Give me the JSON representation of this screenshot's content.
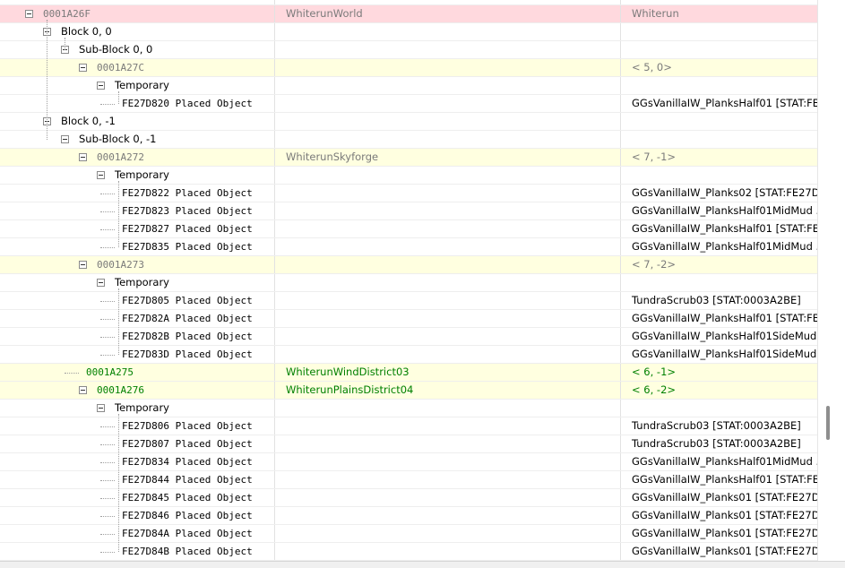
{
  "rows": [
    {
      "indent": 0,
      "expander": false,
      "tree_icon": "plus-icon",
      "c1": "",
      "c2": "",
      "c3": "",
      "bg": "",
      "style": "normal"
    },
    {
      "indent": 1,
      "expander": true,
      "c1": "0001A26F",
      "c2": "WhiterunWorld",
      "c3": "Whiterun",
      "bg": "pink",
      "style": "grey",
      "mono": true
    },
    {
      "indent": 2,
      "expander": true,
      "c1": "Block 0, 0",
      "c2": "",
      "c3": "",
      "bg": "",
      "style": "normal"
    },
    {
      "indent": 3,
      "expander": true,
      "c1": "Sub-Block 0, 0",
      "c2": "",
      "c3": "",
      "bg": "",
      "style": "normal"
    },
    {
      "indent": 4,
      "expander": true,
      "c1": "0001A27C",
      "c2": "",
      "c3": "< 5,  0>",
      "bg": "yellow",
      "style": "grey",
      "mono": true
    },
    {
      "indent": 5,
      "expander": true,
      "c1": "Temporary",
      "c2": "",
      "c3": "",
      "bg": "",
      "style": "normal"
    },
    {
      "indent": 6,
      "expander": false,
      "c1": "FE27D820  Placed Object",
      "c2": "",
      "c3": "GGsVanillaIW_PlanksHalf01 [STAT:FE...",
      "bg": "",
      "style": "normal",
      "mono": true
    },
    {
      "indent": 2,
      "expander": true,
      "c1": "Block 0, -1",
      "c2": "",
      "c3": "",
      "bg": "",
      "style": "normal"
    },
    {
      "indent": 3,
      "expander": true,
      "c1": "Sub-Block 0, -1",
      "c2": "",
      "c3": "",
      "bg": "",
      "style": "normal"
    },
    {
      "indent": 4,
      "expander": true,
      "c1": "0001A272",
      "c2": "WhiterunSkyforge",
      "c3": "< 7, -1>",
      "bg": "yellow",
      "style": "grey",
      "mono": true
    },
    {
      "indent": 5,
      "expander": true,
      "c1": "Temporary",
      "c2": "",
      "c3": "",
      "bg": "",
      "style": "normal"
    },
    {
      "indent": 6,
      "expander": false,
      "c1": "FE27D822  Placed Object",
      "c2": "",
      "c3": "GGsVanillaIW_Planks02 [STAT:FE27D...",
      "bg": "",
      "style": "normal",
      "mono": true
    },
    {
      "indent": 6,
      "expander": false,
      "c1": "FE27D823  Placed Object",
      "c2": "",
      "c3": "GGsVanillaIW_PlanksHalf01MidMud ...",
      "bg": "",
      "style": "normal",
      "mono": true
    },
    {
      "indent": 6,
      "expander": false,
      "c1": "FE27D827  Placed Object",
      "c2": "",
      "c3": "GGsVanillaIW_PlanksHalf01 [STAT:FE...",
      "bg": "",
      "style": "normal",
      "mono": true
    },
    {
      "indent": 6,
      "expander": false,
      "c1": "FE27D835  Placed Object",
      "c2": "",
      "c3": "GGsVanillaIW_PlanksHalf01MidMud ...",
      "bg": "",
      "style": "normal",
      "mono": true
    },
    {
      "indent": 4,
      "expander": true,
      "c1": "0001A273",
      "c2": "",
      "c3": "< 7, -2>",
      "bg": "yellow",
      "style": "grey",
      "mono": true
    },
    {
      "indent": 5,
      "expander": true,
      "c1": "Temporary",
      "c2": "",
      "c3": "",
      "bg": "",
      "style": "normal"
    },
    {
      "indent": 6,
      "expander": false,
      "c1": "FE27D805  Placed Object",
      "c2": "",
      "c3": "TundraScrub03 [STAT:0003A2BE]",
      "bg": "",
      "style": "normal",
      "mono": true
    },
    {
      "indent": 6,
      "expander": false,
      "c1": "FE27D82A  Placed Object",
      "c2": "",
      "c3": "GGsVanillaIW_PlanksHalf01 [STAT:FE...",
      "bg": "",
      "style": "normal",
      "mono": true
    },
    {
      "indent": 6,
      "expander": false,
      "c1": "FE27D82B  Placed Object",
      "c2": "",
      "c3": "GGsVanillaIW_PlanksHalf01SideMud ...",
      "bg": "",
      "style": "normal",
      "mono": true
    },
    {
      "indent": 6,
      "expander": false,
      "c1": "FE27D83D  Placed Object",
      "c2": "",
      "c3": "GGsVanillaIW_PlanksHalf01SideMud ...",
      "bg": "",
      "style": "normal",
      "mono": true
    },
    {
      "indent": 4,
      "expander": false,
      "c1": "0001A275",
      "c2": "WhiterunWindDistrict03",
      "c3": "< 6, -1>",
      "bg": "yellow",
      "style": "green",
      "mono": true
    },
    {
      "indent": 4,
      "expander": true,
      "c1": "0001A276",
      "c2": "WhiterunPlainsDistrict04",
      "c3": "< 6, -2>",
      "bg": "yellow",
      "style": "green",
      "mono": true
    },
    {
      "indent": 5,
      "expander": true,
      "c1": "Temporary",
      "c2": "",
      "c3": "",
      "bg": "",
      "style": "normal"
    },
    {
      "indent": 6,
      "expander": false,
      "c1": "FE27D806  Placed Object",
      "c2": "",
      "c3": "TundraScrub03 [STAT:0003A2BE]",
      "bg": "",
      "style": "normal",
      "mono": true
    },
    {
      "indent": 6,
      "expander": false,
      "c1": "FE27D807  Placed Object",
      "c2": "",
      "c3": "TundraScrub03 [STAT:0003A2BE]",
      "bg": "",
      "style": "normal",
      "mono": true
    },
    {
      "indent": 6,
      "expander": false,
      "c1": "FE27D834  Placed Object",
      "c2": "",
      "c3": "GGsVanillaIW_PlanksHalf01MidMud ...",
      "bg": "",
      "style": "normal",
      "mono": true
    },
    {
      "indent": 6,
      "expander": false,
      "c1": "FE27D844  Placed Object",
      "c2": "",
      "c3": "GGsVanillaIW_PlanksHalf01 [STAT:FE...",
      "bg": "",
      "style": "normal",
      "mono": true
    },
    {
      "indent": 6,
      "expander": false,
      "c1": "FE27D845  Placed Object",
      "c2": "",
      "c3": "GGsVanillaIW_Planks01 [STAT:FE27D...",
      "bg": "",
      "style": "normal",
      "mono": true
    },
    {
      "indent": 6,
      "expander": false,
      "c1": "FE27D846  Placed Object",
      "c2": "",
      "c3": "GGsVanillaIW_Planks01 [STAT:FE27D...",
      "bg": "",
      "style": "normal",
      "mono": true
    },
    {
      "indent": 6,
      "expander": false,
      "c1": "FE27D84A  Placed Object",
      "c2": "",
      "c3": "GGsVanillaIW_Planks01 [STAT:FE27D...",
      "bg": "",
      "style": "normal",
      "mono": true
    },
    {
      "indent": 6,
      "expander": false,
      "c1": "FE27D84B  Placed Object",
      "c2": "",
      "c3": "GGsVanillaIW_Planks01 [STAT:FE27D...",
      "bg": "",
      "style": "normal",
      "mono": true
    }
  ],
  "colors": {
    "row_pink": "#ffd9de",
    "row_yellow": "#ffffe0",
    "text_green": "#008000",
    "text_grey": "#7a7a7a"
  },
  "icons": {
    "expander": "collapse-minus-icon"
  }
}
